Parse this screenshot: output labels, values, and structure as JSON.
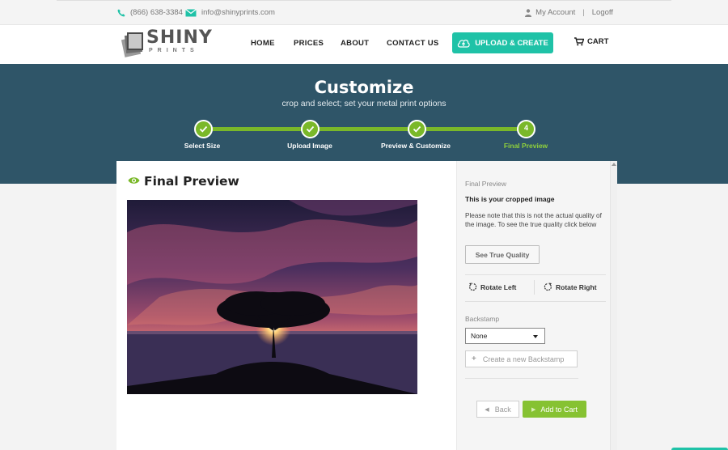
{
  "topbar": {
    "phone": "(866) 638-3384",
    "email": "info@shinyprints.com",
    "account_label": "My Account",
    "separator": "|",
    "logoff_label": "Logoff"
  },
  "header": {
    "logo_text": "SHINY",
    "logo_sub": "PRINTS",
    "nav": [
      "HOME",
      "PRICES",
      "ABOUT",
      "CONTACT US"
    ],
    "upload_label": "UPLOAD & CREATE",
    "cart_label": "CART"
  },
  "banner": {
    "title": "Customize",
    "subtitle": "crop and select; set your metal print options",
    "steps": [
      {
        "label": "Select Size",
        "status": "done"
      },
      {
        "label": "Upload Image",
        "status": "done"
      },
      {
        "label": "Preview & Customize",
        "status": "done"
      },
      {
        "label": "Final Preview",
        "status": "active",
        "number": "4"
      }
    ]
  },
  "preview": {
    "title": "Final Preview"
  },
  "sidebar": {
    "section_label": "Final Preview",
    "heading": "This is your cropped image",
    "note": "Please note that this is not the actual quality of the image. To see the true quality click below",
    "true_quality_label": "See True Quality",
    "rotate_left_label": "Rotate Left",
    "rotate_right_label": "Rotate Right",
    "backstamp_label": "Backstamp",
    "backstamp_value": "None",
    "create_backstamp_label": "Create a new Backstamp",
    "back_label": "Back",
    "add_to_cart_label": "Add to Cart"
  },
  "colors": {
    "accent_teal": "#1fc2a7",
    "banner": "#2f5568",
    "step_green": "#7ab829",
    "cart_green": "#86c232"
  }
}
